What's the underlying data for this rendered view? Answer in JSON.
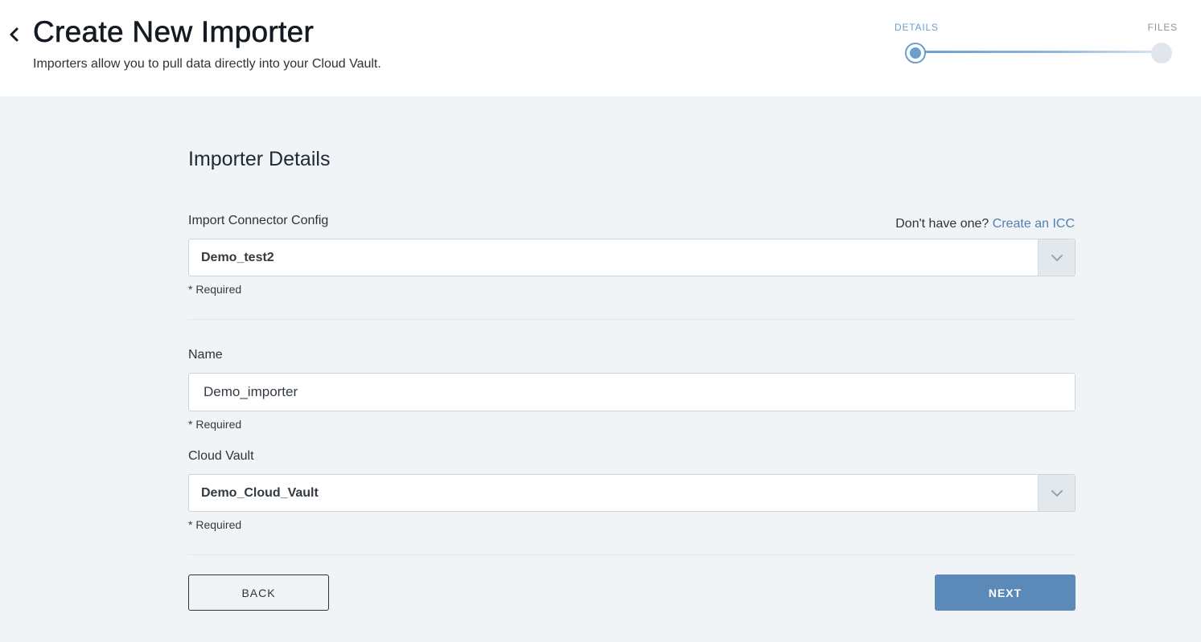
{
  "header": {
    "title": "Create New Importer",
    "subtitle": "Importers allow you to pull data directly into your Cloud Vault.",
    "back_icon": "chevron-left-icon"
  },
  "stepper": {
    "steps": [
      {
        "label": "DETAILS",
        "state": "active"
      },
      {
        "label": "FILES",
        "state": "inactive"
      }
    ],
    "active_color": "#6c9fce"
  },
  "form": {
    "section_title": "Importer Details",
    "icc": {
      "label": "Import Connector Config",
      "help_text": "Don't have one?",
      "help_link": "Create an ICC",
      "value": "Demo_test2",
      "required_note": "* Required",
      "arrow_icon": "chevron-down-icon"
    },
    "name": {
      "label": "Name",
      "value": "Demo_importer",
      "required_note": "* Required"
    },
    "cloud_vault": {
      "label": "Cloud Vault",
      "value": "Demo_Cloud_Vault",
      "required_note": "* Required",
      "arrow_icon": "chevron-down-icon"
    }
  },
  "actions": {
    "back_label": "BACK",
    "next_label": "NEXT",
    "next_color": "#5b8ab8"
  }
}
